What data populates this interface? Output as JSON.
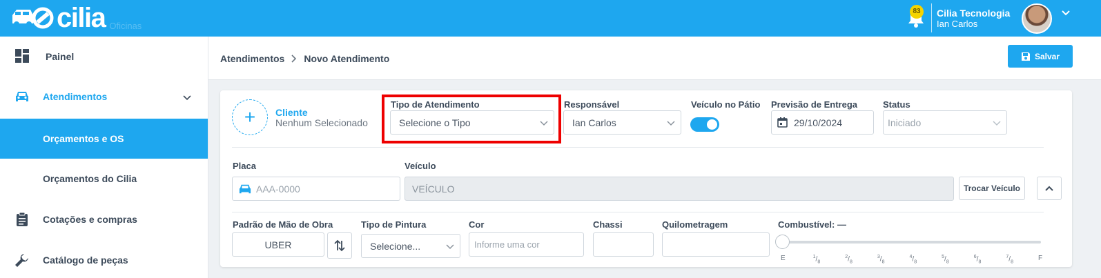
{
  "topbar": {
    "logo_text": "cilia",
    "logo_sub": "Oficinas",
    "notification_count": "83",
    "company": "Cilia Tecnologia",
    "user": "Ian Carlos"
  },
  "sidebar": {
    "items": [
      {
        "label": "Painel",
        "icon": "dashboard-icon"
      },
      {
        "label": "Atendimentos",
        "icon": "car-icon"
      },
      {
        "label": "Orçamentos e OS"
      },
      {
        "label": "Orçamentos do Cilia"
      },
      {
        "label": "Cotações e compras",
        "icon": "clipboard-icon"
      },
      {
        "label": "Catálogo de peças",
        "icon": "wrench-icon"
      }
    ]
  },
  "header": {
    "breadcrumb": [
      "Atendimentos",
      "Novo Atendimento"
    ],
    "save_label": "Salvar"
  },
  "form": {
    "client_title": "Cliente",
    "client_sub": "Nenhum Selecionado",
    "tipo_label": "Tipo de Atendimento",
    "tipo_value": "Selecione o Tipo",
    "responsavel_label": "Responsável",
    "responsavel_value": "Ian Carlos",
    "patio_label": "Veículo no Pátio",
    "patio_on": true,
    "previsao_label": "Previsão de Entrega",
    "previsao_value": "29/10/2024",
    "status_label": "Status",
    "status_value": "Iniciado",
    "placa_label": "Placa",
    "placa_placeholder": "AAA-0000",
    "veiculo_label": "Veículo",
    "veiculo_value": "VEÍCULO",
    "trocar_label": "Trocar Veículo",
    "padrao_label": "Padrão de Mão de Obra",
    "padrao_value": "UBER",
    "pintura_label": "Tipo de Pintura",
    "pintura_value": "Selecione...",
    "cor_label": "Cor",
    "cor_placeholder": "Informe uma cor",
    "chassi_label": "Chassi",
    "quilometragem_label": "Quilometragem",
    "combustivel_label": "Combustível: —",
    "combustivel_level": 0,
    "fuel_ticks": [
      {
        "n": "",
        "d": "",
        "t": "E"
      },
      {
        "n": "1",
        "d": "8"
      },
      {
        "n": "2",
        "d": "8"
      },
      {
        "n": "3",
        "d": "8"
      },
      {
        "n": "4",
        "d": "8"
      },
      {
        "n": "5",
        "d": "8"
      },
      {
        "n": "6",
        "d": "8"
      },
      {
        "n": "7",
        "d": "8"
      },
      {
        "n": "",
        "d": "",
        "t": "F"
      }
    ]
  },
  "colors": {
    "accent": "#1ea7ef",
    "highlight": "#ee0000",
    "badge": "#f5d400"
  }
}
